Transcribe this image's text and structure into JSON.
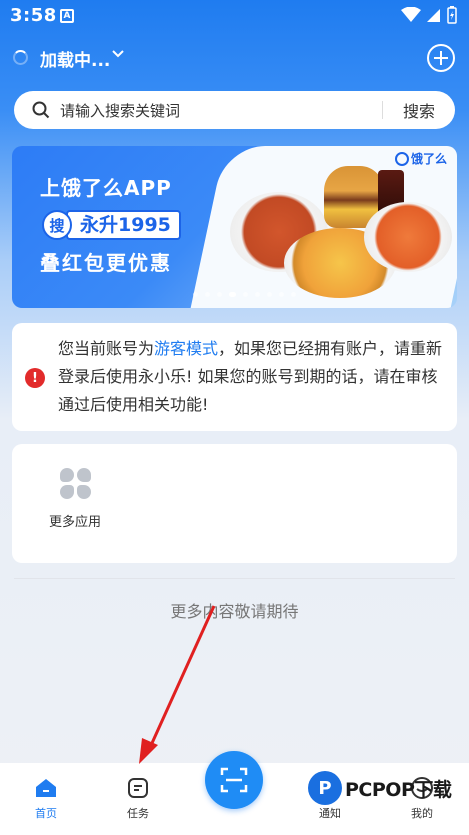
{
  "status_bar": {
    "time": "3:58",
    "notification_glyph": "A"
  },
  "header": {
    "location_label": "加载中...",
    "icons": [
      "loading-spinner",
      "chevron-down-icon",
      "add-circle-icon"
    ]
  },
  "search": {
    "placeholder": "请输入搜索关键词",
    "button_label": "搜索"
  },
  "banner": {
    "line1": "上饿了么APP",
    "search_tag": "搜",
    "keyword": "永升1995",
    "line3": "叠红包更优惠",
    "brand": "饿了么",
    "carousel_active_index": 3,
    "carousel_count": 9
  },
  "notice": {
    "icon": "alert-icon",
    "text_before": "您当前账号为",
    "link_text": "游客模式",
    "text_after": "，如果您已经拥有账户，请重新登录后使用永小乐! 如果您的账号到期的话，请在审核通过后使用相关功能!"
  },
  "apps": {
    "more_apps_label": "更多应用"
  },
  "footer_message": "更多内容敬请期待",
  "bottom_nav": {
    "items": [
      {
        "label": "首页",
        "icon": "home-icon",
        "active": true
      },
      {
        "label": "任务",
        "icon": "task-icon",
        "active": false
      },
      {
        "label": "通知",
        "icon": "bell-icon",
        "active": false
      },
      {
        "label": "我的",
        "icon": "user-icon",
        "active": false
      }
    ],
    "center_icon": "scan-icon"
  },
  "watermark": {
    "logo_glyph": "P",
    "text": "PCPOP下载"
  },
  "colors": {
    "primary": "#1f7cf0",
    "alert": "#e22b2b",
    "annotation": "#e02020"
  }
}
